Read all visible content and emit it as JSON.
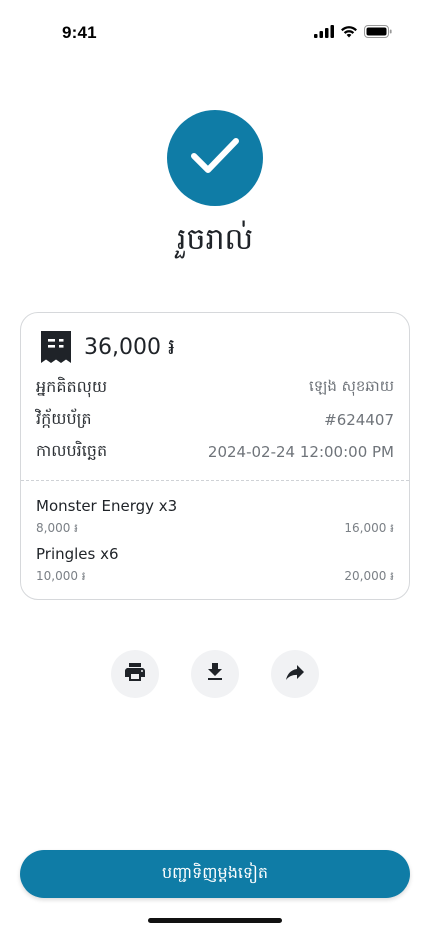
{
  "status_bar": {
    "time": "9:41",
    "icons": [
      "signal-icon",
      "wifi-icon",
      "battery-icon"
    ]
  },
  "success": {
    "icon": "check-icon",
    "title": "រួចរាល់",
    "color": "#0f7ca6"
  },
  "receipt": {
    "icon": "receipt-icon",
    "total": "36,000 ៛",
    "rows": [
      {
        "label": "អ្នកគិតលុយ",
        "value": "ឡេង សុខឆាយ"
      },
      {
        "label": "វិក្ក័យប័ត្រ",
        "value": "#624407"
      },
      {
        "label": "កាលបរិច្ឆេត",
        "value": "2024-02-24 12:00:00 PM"
      }
    ],
    "items": [
      {
        "name": "Monster Energy x3",
        "unit_price": "8,000 ៛",
        "subtotal": "16,000 ៛"
      },
      {
        "name": "Pringles x6",
        "unit_price": "10,000 ៛",
        "subtotal": "20,000 ៛"
      }
    ]
  },
  "actions": [
    {
      "icon": "print-icon"
    },
    {
      "icon": "download-icon"
    },
    {
      "icon": "share-icon"
    }
  ],
  "primary_button": {
    "label": "បញ្ជាទិញម្តងទៀត",
    "color": "#0f7ca6"
  }
}
